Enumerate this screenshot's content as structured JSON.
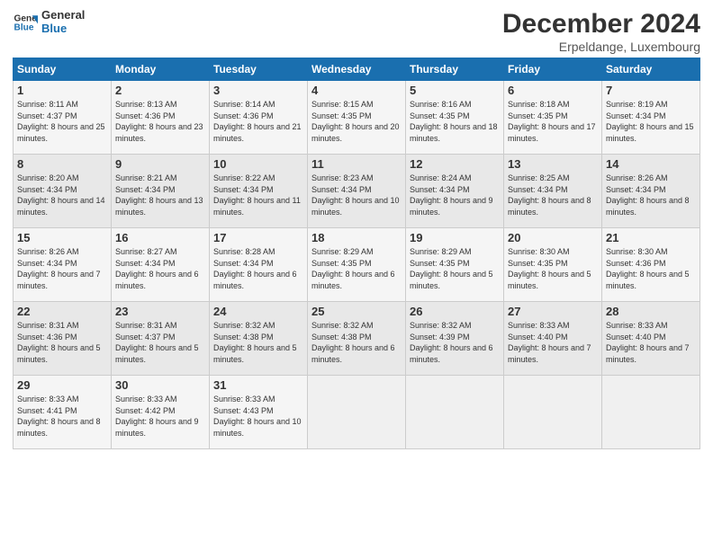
{
  "header": {
    "logo_line1": "General",
    "logo_line2": "Blue",
    "month": "December 2024",
    "location": "Erpeldange, Luxembourg"
  },
  "days_of_week": [
    "Sunday",
    "Monday",
    "Tuesday",
    "Wednesday",
    "Thursday",
    "Friday",
    "Saturday"
  ],
  "weeks": [
    [
      {
        "day": "1",
        "sunrise": "8:11 AM",
        "sunset": "4:37 PM",
        "daylight": "8 hours and 25 minutes."
      },
      {
        "day": "2",
        "sunrise": "8:13 AM",
        "sunset": "4:36 PM",
        "daylight": "8 hours and 23 minutes."
      },
      {
        "day": "3",
        "sunrise": "8:14 AM",
        "sunset": "4:36 PM",
        "daylight": "8 hours and 21 minutes."
      },
      {
        "day": "4",
        "sunrise": "8:15 AM",
        "sunset": "4:35 PM",
        "daylight": "8 hours and 20 minutes."
      },
      {
        "day": "5",
        "sunrise": "8:16 AM",
        "sunset": "4:35 PM",
        "daylight": "8 hours and 18 minutes."
      },
      {
        "day": "6",
        "sunrise": "8:18 AM",
        "sunset": "4:35 PM",
        "daylight": "8 hours and 17 minutes."
      },
      {
        "day": "7",
        "sunrise": "8:19 AM",
        "sunset": "4:34 PM",
        "daylight": "8 hours and 15 minutes."
      }
    ],
    [
      {
        "day": "8",
        "sunrise": "8:20 AM",
        "sunset": "4:34 PM",
        "daylight": "8 hours and 14 minutes."
      },
      {
        "day": "9",
        "sunrise": "8:21 AM",
        "sunset": "4:34 PM",
        "daylight": "8 hours and 13 minutes."
      },
      {
        "day": "10",
        "sunrise": "8:22 AM",
        "sunset": "4:34 PM",
        "daylight": "8 hours and 11 minutes."
      },
      {
        "day": "11",
        "sunrise": "8:23 AM",
        "sunset": "4:34 PM",
        "daylight": "8 hours and 10 minutes."
      },
      {
        "day": "12",
        "sunrise": "8:24 AM",
        "sunset": "4:34 PM",
        "daylight": "8 hours and 9 minutes."
      },
      {
        "day": "13",
        "sunrise": "8:25 AM",
        "sunset": "4:34 PM",
        "daylight": "8 hours and 8 minutes."
      },
      {
        "day": "14",
        "sunrise": "8:26 AM",
        "sunset": "4:34 PM",
        "daylight": "8 hours and 8 minutes."
      }
    ],
    [
      {
        "day": "15",
        "sunrise": "8:26 AM",
        "sunset": "4:34 PM",
        "daylight": "8 hours and 7 minutes."
      },
      {
        "day": "16",
        "sunrise": "8:27 AM",
        "sunset": "4:34 PM",
        "daylight": "8 hours and 6 minutes."
      },
      {
        "day": "17",
        "sunrise": "8:28 AM",
        "sunset": "4:34 PM",
        "daylight": "8 hours and 6 minutes."
      },
      {
        "day": "18",
        "sunrise": "8:29 AM",
        "sunset": "4:35 PM",
        "daylight": "8 hours and 6 minutes."
      },
      {
        "day": "19",
        "sunrise": "8:29 AM",
        "sunset": "4:35 PM",
        "daylight": "8 hours and 5 minutes."
      },
      {
        "day": "20",
        "sunrise": "8:30 AM",
        "sunset": "4:35 PM",
        "daylight": "8 hours and 5 minutes."
      },
      {
        "day": "21",
        "sunrise": "8:30 AM",
        "sunset": "4:36 PM",
        "daylight": "8 hours and 5 minutes."
      }
    ],
    [
      {
        "day": "22",
        "sunrise": "8:31 AM",
        "sunset": "4:36 PM",
        "daylight": "8 hours and 5 minutes."
      },
      {
        "day": "23",
        "sunrise": "8:31 AM",
        "sunset": "4:37 PM",
        "daylight": "8 hours and 5 minutes."
      },
      {
        "day": "24",
        "sunrise": "8:32 AM",
        "sunset": "4:38 PM",
        "daylight": "8 hours and 5 minutes."
      },
      {
        "day": "25",
        "sunrise": "8:32 AM",
        "sunset": "4:38 PM",
        "daylight": "8 hours and 6 minutes."
      },
      {
        "day": "26",
        "sunrise": "8:32 AM",
        "sunset": "4:39 PM",
        "daylight": "8 hours and 6 minutes."
      },
      {
        "day": "27",
        "sunrise": "8:33 AM",
        "sunset": "4:40 PM",
        "daylight": "8 hours and 7 minutes."
      },
      {
        "day": "28",
        "sunrise": "8:33 AM",
        "sunset": "4:40 PM",
        "daylight": "8 hours and 7 minutes."
      }
    ],
    [
      {
        "day": "29",
        "sunrise": "8:33 AM",
        "sunset": "4:41 PM",
        "daylight": "8 hours and 8 minutes."
      },
      {
        "day": "30",
        "sunrise": "8:33 AM",
        "sunset": "4:42 PM",
        "daylight": "8 hours and 9 minutes."
      },
      {
        "day": "31",
        "sunrise": "8:33 AM",
        "sunset": "4:43 PM",
        "daylight": "8 hours and 10 minutes."
      },
      null,
      null,
      null,
      null
    ]
  ]
}
